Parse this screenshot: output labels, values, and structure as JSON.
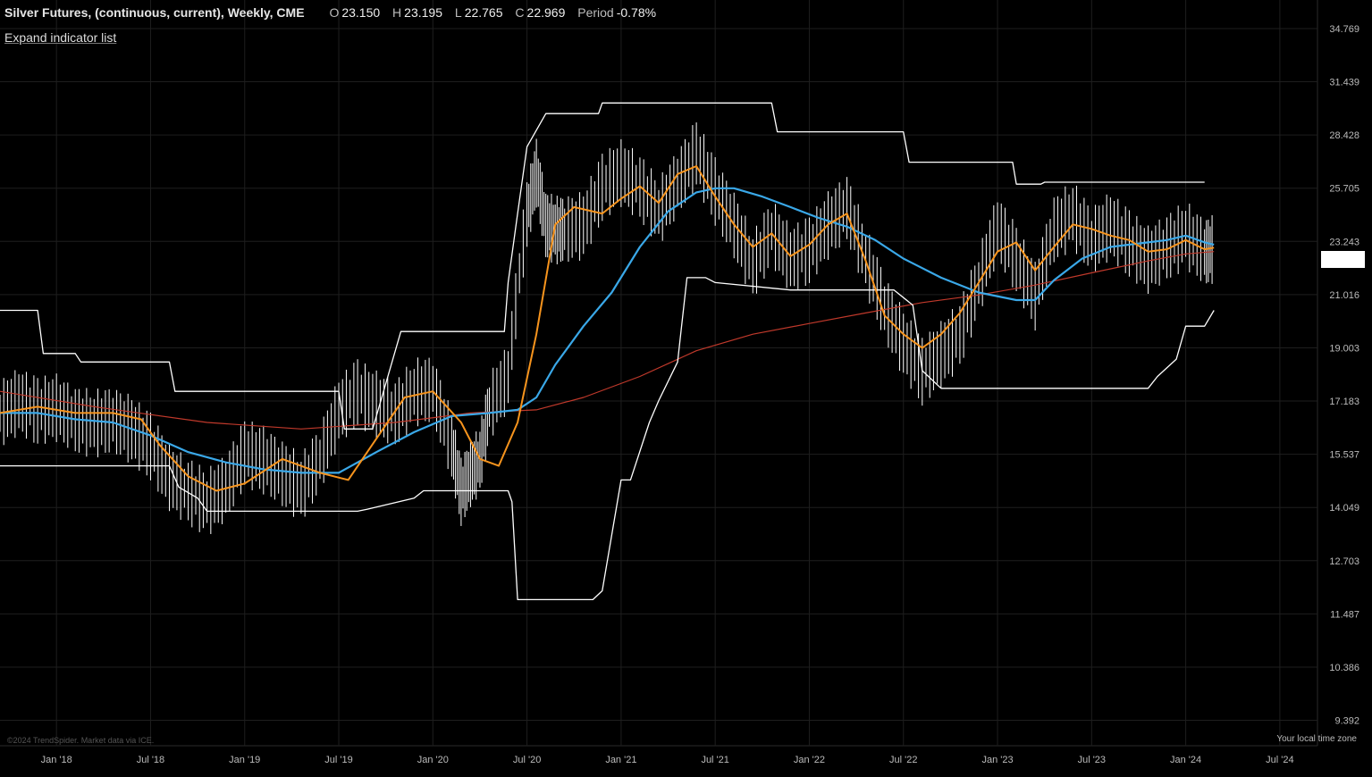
{
  "header": {
    "symbol": "Silver Futures, (continuous, current), Weekly, CME",
    "open_label": "O",
    "open": "23.150",
    "high_label": "H",
    "high": "23.195",
    "low_label": "L",
    "low": "22.765",
    "close_label": "C",
    "close": "22.969",
    "period_label": "Period",
    "period": "-0.78%"
  },
  "expand_indicators_label": "Expand indicator list",
  "footer": {
    "copyright": "©2024 TrendSpider. Market data via ICE.",
    "timezone": "Your local time zone"
  },
  "colors": {
    "background": "#000000",
    "grid": "#1e1e1e",
    "bars": "#ffffff",
    "channel": "#ffffff",
    "ema_fast": "#f7941d",
    "ema_slow": "#3aa8e8",
    "ma_long": "#c0392b",
    "price_tag": "#ffffff"
  },
  "chart_data": {
    "type": "line",
    "grid": true,
    "x_ticks": [
      "Jan '18",
      "Jul '18",
      "Jan '19",
      "Jul '19",
      "Jan '20",
      "Jul '20",
      "Jan '21",
      "Jul '21",
      "Jan '22",
      "Jul '22",
      "Jan '23",
      "Jul '23",
      "Jan '24",
      "Jul '24"
    ],
    "y_ticks": [
      "34.769",
      "31.439",
      "28.428",
      "25.705",
      "23.243",
      "21.016",
      "19.003",
      "17.183",
      "15.537",
      "14.049",
      "12.703",
      "11.487",
      "10.386",
      "9.392"
    ],
    "x_range": [
      "2017.70",
      "2024.70"
    ],
    "y_range": [
      8.95,
      36.7
    ],
    "y_scale": "log",
    "current_price": 22.969,
    "series": [
      {
        "role": "price_close",
        "style": "ohlc_bars",
        "x": [
          2017.7,
          2017.8,
          2017.9,
          2018.0,
          2018.1,
          2018.2,
          2018.3,
          2018.4,
          2018.5,
          2018.6,
          2018.7,
          2018.8,
          2018.9,
          2019.0,
          2019.1,
          2019.2,
          2019.3,
          2019.4,
          2019.5,
          2019.6,
          2019.7,
          2019.8,
          2019.9,
          2020.0,
          2020.1,
          2020.15,
          2020.2,
          2020.25,
          2020.3,
          2020.4,
          2020.5,
          2020.55,
          2020.6,
          2020.65,
          2020.7,
          2020.8,
          2020.9,
          2021.0,
          2021.1,
          2021.2,
          2021.3,
          2021.4,
          2021.5,
          2021.6,
          2021.7,
          2021.8,
          2021.9,
          2022.0,
          2022.1,
          2022.2,
          2022.3,
          2022.4,
          2022.5,
          2022.6,
          2022.7,
          2022.8,
          2022.9,
          2023.0,
          2023.1,
          2023.2,
          2023.3,
          2023.4,
          2023.5,
          2023.6,
          2023.7,
          2023.8,
          2023.9,
          2024.0,
          2024.1,
          2024.15
        ],
        "y": [
          16.8,
          17.2,
          16.9,
          17.0,
          16.6,
          16.5,
          16.6,
          16.3,
          15.8,
          14.9,
          14.5,
          14.2,
          14.6,
          15.6,
          15.4,
          15.0,
          14.6,
          15.4,
          16.9,
          17.5,
          17.1,
          16.8,
          17.5,
          17.6,
          15.8,
          14.5,
          15.0,
          15.4,
          17.0,
          18.0,
          24.5,
          26.5,
          24.0,
          23.8,
          23.8,
          24.0,
          25.8,
          26.5,
          25.8,
          24.6,
          26.0,
          27.5,
          25.6,
          24.0,
          22.2,
          23.7,
          22.5,
          22.9,
          24.0,
          24.8,
          22.5,
          20.5,
          19.2,
          18.2,
          18.8,
          19.5,
          21.5,
          23.9,
          22.5,
          21.0,
          23.8,
          24.5,
          23.3,
          24.0,
          23.2,
          22.5,
          23.0,
          23.6,
          22.8,
          22.969
        ]
      },
      {
        "role": "channel_upper",
        "x": [
          2017.7,
          2017.9,
          2017.93,
          2018.1,
          2018.13,
          2018.6,
          2018.63,
          2019.5,
          2019.53,
          2019.68,
          2019.83,
          2019.9,
          2020.38,
          2020.4,
          2020.45,
          2020.5,
          2020.6,
          2020.65,
          2020.88,
          2020.9,
          2021.05,
          2021.8,
          2021.83,
          2022.5,
          2022.53,
          2023.08,
          2023.1,
          2023.23,
          2023.25,
          2024.0,
          2024.1
        ],
        "y": [
          20.4,
          20.4,
          18.8,
          18.8,
          18.5,
          18.5,
          17.5,
          17.5,
          16.3,
          16.3,
          19.6,
          19.6,
          19.6,
          21.5,
          24.5,
          27.8,
          29.6,
          29.6,
          29.6,
          30.2,
          30.2,
          30.2,
          28.6,
          28.6,
          27.0,
          27.0,
          25.9,
          25.9,
          26.0,
          26.0,
          26.0
        ]
      },
      {
        "role": "channel_lower",
        "x": [
          2017.7,
          2018.6,
          2018.65,
          2018.75,
          2018.8,
          2019.6,
          2019.65,
          2019.9,
          2019.95,
          2020.4,
          2020.42,
          2020.45,
          2020.5,
          2020.85,
          2020.9,
          2021.0,
          2021.05,
          2021.15,
          2021.2,
          2021.3,
          2021.35,
          2021.45,
          2021.5,
          2021.9,
          2022.0,
          2022.45,
          2022.55,
          2022.6,
          2022.7,
          2023.2,
          2023.3,
          2023.8,
          2023.85,
          2023.95,
          2024.0,
          2024.1,
          2024.15
        ],
        "y": [
          15.2,
          15.2,
          14.6,
          14.3,
          13.95,
          13.95,
          14.0,
          14.3,
          14.5,
          14.5,
          14.2,
          11.8,
          11.8,
          11.8,
          12.0,
          14.8,
          14.8,
          16.5,
          17.2,
          18.5,
          21.7,
          21.7,
          21.5,
          21.2,
          21.2,
          21.2,
          20.6,
          18.2,
          17.6,
          17.6,
          17.6,
          17.6,
          18.0,
          18.6,
          19.8,
          19.8,
          20.4
        ]
      },
      {
        "role": "ema_fast",
        "x": [
          2017.7,
          2017.9,
          2018.1,
          2018.3,
          2018.45,
          2018.55,
          2018.7,
          2018.85,
          2019.0,
          2019.2,
          2019.4,
          2019.55,
          2019.7,
          2019.85,
          2020.0,
          2020.15,
          2020.25,
          2020.35,
          2020.45,
          2020.55,
          2020.65,
          2020.75,
          2020.9,
          2021.0,
          2021.1,
          2021.2,
          2021.3,
          2021.4,
          2021.5,
          2021.6,
          2021.7,
          2021.8,
          2021.9,
          2022.0,
          2022.1,
          2022.2,
          2022.3,
          2022.4,
          2022.5,
          2022.6,
          2022.7,
          2022.8,
          2022.9,
          2023.0,
          2023.1,
          2023.2,
          2023.3,
          2023.4,
          2023.5,
          2023.6,
          2023.7,
          2023.8,
          2023.9,
          2024.0,
          2024.1,
          2024.15
        ],
        "y": [
          16.8,
          17.0,
          16.8,
          16.8,
          16.6,
          15.8,
          14.9,
          14.5,
          14.7,
          15.4,
          15.0,
          14.8,
          16.0,
          17.3,
          17.5,
          16.5,
          15.4,
          15.2,
          16.5,
          19.5,
          24.0,
          24.8,
          24.5,
          25.2,
          25.8,
          25.0,
          26.4,
          26.8,
          25.3,
          24.0,
          23.0,
          23.6,
          22.6,
          23.1,
          24.0,
          24.5,
          22.4,
          20.2,
          19.5,
          19.0,
          19.5,
          20.3,
          21.5,
          22.8,
          23.2,
          22.0,
          23.0,
          24.0,
          23.8,
          23.5,
          23.3,
          22.8,
          22.9,
          23.3,
          22.9,
          22.969
        ]
      },
      {
        "role": "ema_slow",
        "x": [
          2017.7,
          2017.9,
          2018.1,
          2018.3,
          2018.5,
          2018.7,
          2018.9,
          2019.1,
          2019.3,
          2019.5,
          2019.7,
          2019.9,
          2020.1,
          2020.3,
          2020.45,
          2020.55,
          2020.65,
          2020.8,
          2020.95,
          2021.1,
          2021.25,
          2021.4,
          2021.5,
          2021.6,
          2021.75,
          2021.9,
          2022.05,
          2022.2,
          2022.35,
          2022.5,
          2022.7,
          2022.9,
          2023.1,
          2023.2,
          2023.3,
          2023.45,
          2023.6,
          2023.8,
          2023.9,
          2024.0,
          2024.1,
          2024.15
        ],
        "y": [
          16.8,
          16.8,
          16.6,
          16.5,
          16.1,
          15.6,
          15.3,
          15.1,
          15.0,
          15.0,
          15.6,
          16.2,
          16.7,
          16.8,
          16.9,
          17.3,
          18.4,
          19.8,
          21.1,
          23.0,
          24.6,
          25.5,
          25.7,
          25.7,
          25.3,
          24.8,
          24.3,
          23.9,
          23.3,
          22.5,
          21.7,
          21.1,
          20.8,
          20.8,
          21.6,
          22.5,
          23.0,
          23.2,
          23.3,
          23.5,
          23.2,
          23.1
        ]
      },
      {
        "role": "ma_long",
        "x": [
          2017.7,
          2018.2,
          2018.8,
          2019.3,
          2019.8,
          2020.2,
          2020.55,
          2020.8,
          2021.1,
          2021.4,
          2021.7,
          2022.0,
          2022.3,
          2022.6,
          2022.9,
          2023.2,
          2023.5,
          2023.8,
          2024.0,
          2024.15
        ],
        "y": [
          17.5,
          17.0,
          16.5,
          16.3,
          16.5,
          16.8,
          16.9,
          17.3,
          18.0,
          18.9,
          19.5,
          19.9,
          20.3,
          20.7,
          21.0,
          21.4,
          21.9,
          22.4,
          22.7,
          22.8
        ]
      }
    ]
  }
}
